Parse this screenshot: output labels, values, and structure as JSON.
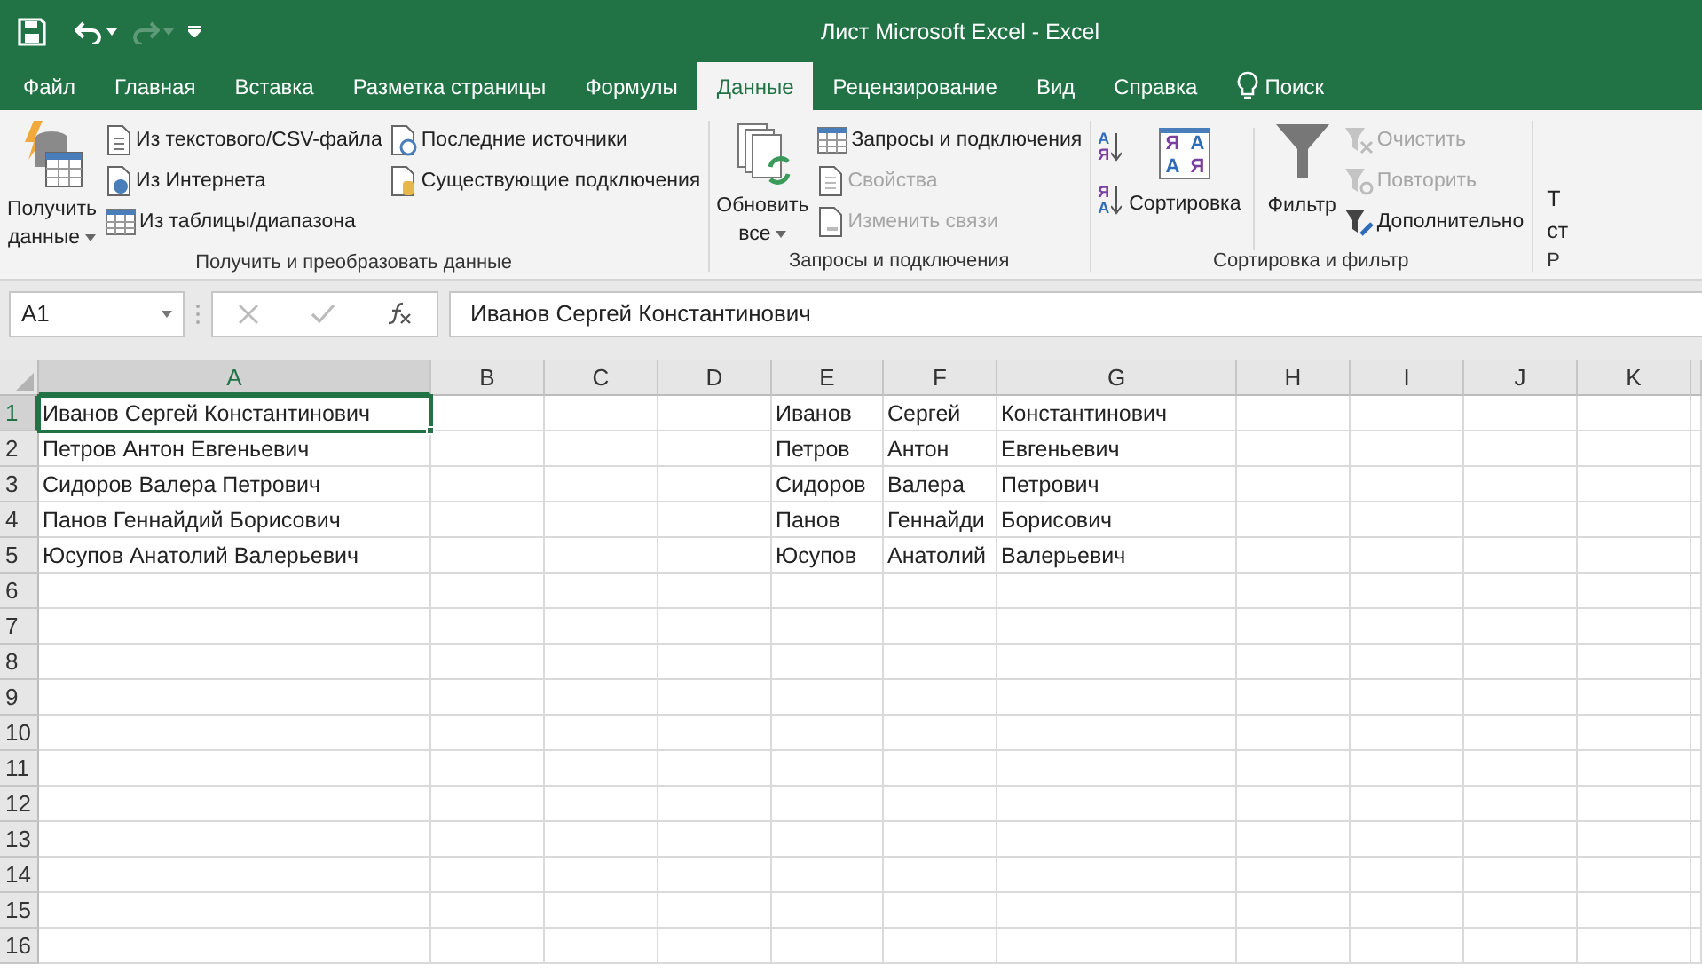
{
  "window": {
    "title": "Лист Microsoft Excel  -  Excel",
    "quick_access": {
      "redo_disabled": true
    }
  },
  "tabs": [
    {
      "label": "Файл",
      "selected": false
    },
    {
      "label": "Главная",
      "selected": false
    },
    {
      "label": "Вставка",
      "selected": false
    },
    {
      "label": "Разметка страницы",
      "selected": false
    },
    {
      "label": "Формулы",
      "selected": false
    },
    {
      "label": "Данные",
      "selected": true
    },
    {
      "label": "Рецензирование",
      "selected": false
    },
    {
      "label": "Вид",
      "selected": false
    },
    {
      "label": "Справка",
      "selected": false
    }
  ],
  "search": {
    "label": "Поиск"
  },
  "ribbon": {
    "groups": [
      {
        "label": "Получить и преобразовать данные",
        "large": {
          "lines": [
            "Получить",
            "данные"
          ]
        },
        "columns": [
          [
            {
              "label": "Из текстового/CSV-файла",
              "disabled": false
            },
            {
              "label": "Из Интернета",
              "disabled": false
            },
            {
              "label": "Из таблицы/диапазона",
              "disabled": false
            }
          ],
          [
            {
              "label": "Последние источники",
              "disabled": false
            },
            {
              "label": "Существующие подключения",
              "disabled": false
            }
          ]
        ]
      },
      {
        "label": "Запросы и подключения",
        "large": {
          "lines": [
            "Обновить",
            "все"
          ]
        },
        "columns": [
          [
            {
              "label": "Запросы и подключения",
              "disabled": false
            },
            {
              "label": "Свойства",
              "disabled": true
            },
            {
              "label": "Изменить связи",
              "disabled": true
            }
          ]
        ]
      },
      {
        "label": "Сортировка и фильтр",
        "sort_small": [
          {
            "letters": [
              "А",
              "Я"
            ]
          },
          {
            "letters": [
              "Я",
              "А"
            ]
          }
        ],
        "sort": {
          "label": "Сортировка",
          "letters": [
            "Я",
            "А",
            "А",
            "Я"
          ]
        },
        "filter": {
          "label": "Фильтр"
        },
        "columns": [
          [
            {
              "label": "Очистить",
              "disabled": true
            },
            {
              "label": "Повторить",
              "disabled": true
            },
            {
              "label": "Дополнительно",
              "disabled": false
            }
          ]
        ]
      }
    ],
    "cut_group": {
      "lines": [
        "Т",
        "ст"
      ],
      "label": "Р"
    }
  },
  "formula_bar": {
    "name_box": "A1",
    "value": "Иванов Сергей Константинович"
  },
  "sheet": {
    "columns": [
      {
        "label": "A",
        "selected": true
      },
      {
        "label": "B",
        "selected": false
      },
      {
        "label": "C",
        "selected": false
      },
      {
        "label": "D",
        "selected": false
      },
      {
        "label": "E",
        "selected": false
      },
      {
        "label": "F",
        "selected": false
      },
      {
        "label": "G",
        "selected": false
      },
      {
        "label": "H",
        "selected": false
      },
      {
        "label": "I",
        "selected": false
      },
      {
        "label": "J",
        "selected": false
      },
      {
        "label": "K",
        "selected": false
      }
    ],
    "rows": [
      {
        "label": "1",
        "selected": true,
        "cells": [
          {
            "text": "Иванов Сергей Константинович",
            "selected": true
          },
          null,
          null,
          null,
          {
            "text": "Иванов",
            "selected": false
          },
          {
            "text": "Сергей",
            "selected": false
          },
          {
            "text": "Константинович",
            "selected": false
          },
          null,
          null,
          null,
          null
        ]
      },
      {
        "label": "2",
        "selected": false,
        "cells": [
          {
            "text": "Петров Антон Евгеньевич",
            "selected": false
          },
          null,
          null,
          null,
          {
            "text": "Петров",
            "selected": false
          },
          {
            "text": "Антон",
            "selected": false
          },
          {
            "text": "Евгеньевич",
            "selected": false
          },
          null,
          null,
          null,
          null
        ]
      },
      {
        "label": "3",
        "selected": false,
        "cells": [
          {
            "text": "Сидоров Валера Петрович",
            "selected": false
          },
          null,
          null,
          null,
          {
            "text": "Сидоров",
            "selected": false
          },
          {
            "text": "Валера",
            "selected": false
          },
          {
            "text": "Петрович",
            "selected": false
          },
          null,
          null,
          null,
          null
        ]
      },
      {
        "label": "4",
        "selected": false,
        "cells": [
          {
            "text": "Панов Геннайдий Борисович",
            "selected": false
          },
          null,
          null,
          null,
          {
            "text": "Панов",
            "selected": false
          },
          {
            "text": "Геннайди",
            "selected": false
          },
          {
            "text": "Борисович",
            "selected": false
          },
          null,
          null,
          null,
          null
        ]
      },
      {
        "label": "5",
        "selected": false,
        "cells": [
          {
            "text": "Юсупов Анатолий Валерьевич",
            "selected": false
          },
          null,
          null,
          null,
          {
            "text": "Юсупов",
            "selected": false
          },
          {
            "text": "Анатолий",
            "selected": false
          },
          {
            "text": "Валерьевич",
            "selected": false
          },
          null,
          null,
          null,
          null
        ]
      },
      {
        "label": "6",
        "selected": false
      },
      {
        "label": "7",
        "selected": false
      },
      {
        "label": "8",
        "selected": false
      },
      {
        "label": "9",
        "selected": false
      },
      {
        "label": "10",
        "selected": false
      },
      {
        "label": "11",
        "selected": false
      },
      {
        "label": "12",
        "selected": false
      },
      {
        "label": "13",
        "selected": false
      },
      {
        "label": "14",
        "selected": false
      },
      {
        "label": "15",
        "selected": false
      },
      {
        "label": "16",
        "selected": false
      }
    ]
  }
}
